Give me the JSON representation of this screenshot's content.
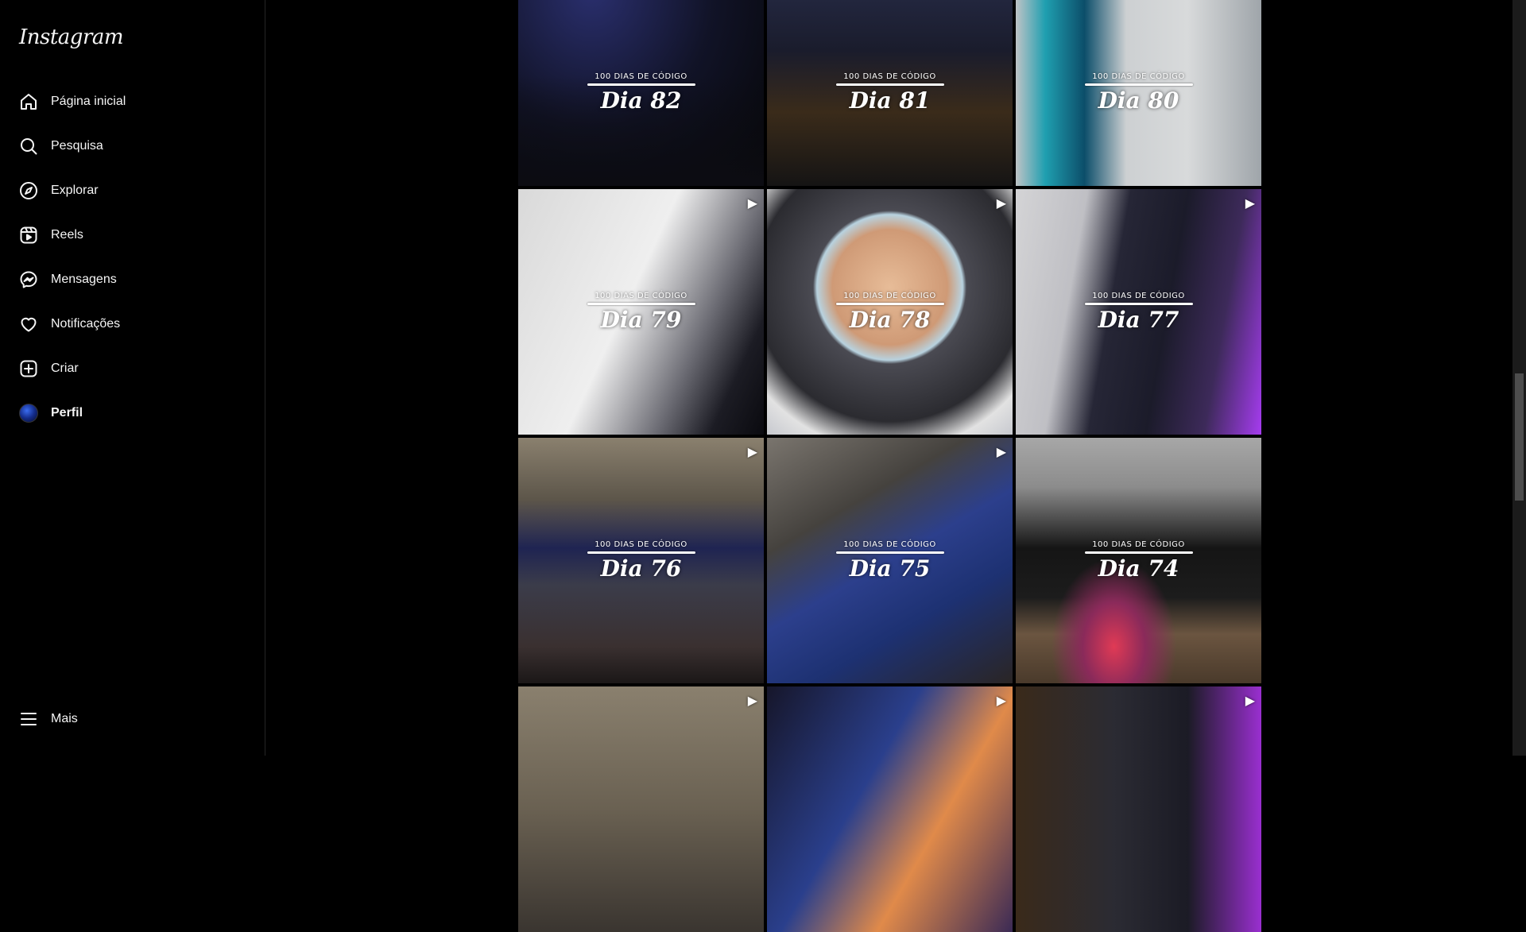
{
  "app": {
    "logo": "Instagram"
  },
  "nav": [
    {
      "label": "Página inicial",
      "icon": "home-icon"
    },
    {
      "label": "Pesquisa",
      "icon": "search-icon"
    },
    {
      "label": "Explorar",
      "icon": "compass-icon"
    },
    {
      "label": "Reels",
      "icon": "reels-icon"
    },
    {
      "label": "Mensagens",
      "icon": "messenger-icon"
    },
    {
      "label": "Notificações",
      "icon": "heart-icon"
    },
    {
      "label": "Criar",
      "icon": "plus-square-icon"
    },
    {
      "label": "Perfil",
      "icon": "avatar"
    }
  ],
  "more": {
    "label": "Mais",
    "icon": "menu-icon"
  },
  "posts": [
    {
      "subtitle": "100 DIAS DE CÓDIGO",
      "day": "Dia 82",
      "reel": false
    },
    {
      "subtitle": "100 DIAS DE CÓDIGO",
      "day": "Dia 81",
      "reel": false
    },
    {
      "subtitle": "100 DIAS DE CÓDIGO",
      "day": "Dia 80",
      "reel": false
    },
    {
      "subtitle": "100 DIAS DE CÓDIGO",
      "day": "Dia 79",
      "reel": true
    },
    {
      "subtitle": "100 DIAS DE CÓDIGO",
      "day": "Dia 78",
      "reel": true
    },
    {
      "subtitle": "100 DIAS DE CÓDIGO",
      "day": "Dia 77",
      "reel": true
    },
    {
      "subtitle": "100 DIAS DE CÓDIGO",
      "day": "Dia 76",
      "reel": true
    },
    {
      "subtitle": "100 DIAS DE CÓDIGO",
      "day": "Dia 75",
      "reel": true
    },
    {
      "subtitle": "100 DIAS DE CÓDIGO",
      "day": "Dia 74",
      "reel": false
    },
    {
      "subtitle": "",
      "day": "",
      "reel": true
    },
    {
      "subtitle": "",
      "day": "",
      "reel": true
    },
    {
      "subtitle": "",
      "day": "",
      "reel": true
    }
  ],
  "colors": {
    "background": "#000000",
    "text": "#f5f5f5",
    "divider": "#262626"
  }
}
